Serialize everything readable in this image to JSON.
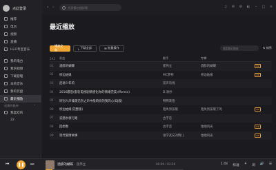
{
  "profile": {
    "login_label": "点此登录"
  },
  "sidebar": {
    "items": [
      {
        "label": "推荐",
        "active": false
      },
      {
        "label": "电台",
        "active": false
      },
      {
        "label": "视频",
        "active": false
      },
      {
        "label": "直播",
        "active": false
      },
      {
        "label": "Hi-Fi专区音乐",
        "active": false
      }
    ],
    "my_music": [
      {
        "label": "我的电台",
        "active": false
      },
      {
        "label": "我的视频",
        "active": false
      },
      {
        "label": "下载管理",
        "active": false
      },
      {
        "label": "本地音乐",
        "active": false
      },
      {
        "label": "我的云盘",
        "active": false
      },
      {
        "label": "最近播放",
        "active": true
      }
    ],
    "created_section": "创建的歌单",
    "liked": {
      "label": "我喜欢的",
      "count_label": "22"
    }
  },
  "topbar": {
    "search_placeholder": "大家都在搜好歌"
  },
  "main": {
    "title": "最近播放",
    "toolbar": {
      "play_all": "播放全部",
      "download_all": "下载全部",
      "batch": "批量操作",
      "search_placeholder": "搜索最近播放",
      "sort": "排序"
    },
    "columns": {
      "idx": "292",
      "title": "歌曲",
      "artist": "歌手",
      "album": "专辑"
    },
    "rows": [
      {
        "idx": "01",
        "title": "酒醉的蝴蝶",
        "artist": "崔伟立",
        "album": "酒醉的蝴蝶",
        "tag": "VIP"
      },
      {
        "idx": "02",
        "title": "桥边姑娘",
        "artist": "MC梦柯",
        "album": "桥边姑娘",
        "tag": "VIP"
      },
      {
        "idx": "03",
        "title": "后退少年的",
        "artist": "双声有线",
        "album": "",
        "tag": ""
      },
      {
        "idx": "04",
        "title": "2016最后(套装电视剧情感化你的情绪完美)(Remix)",
        "artist": "D.清抄",
        "album": "",
        "tag": ""
      },
      {
        "idx": "05",
        "title": "听别人声嗓落无奈之声中能响亮的我的心(DJ版)",
        "artist": "鸭鸭来抱",
        "album": "",
        "tag": ""
      },
      {
        "idx": "06",
        "title": "桥边姑娘(完整版)",
        "artist": "陌失男孩版",
        "album": "陌失男孩版了的",
        "tag": "VIP"
      },
      {
        "idx": "07",
        "title": "说猪水渡行路",
        "artist": "古字恋",
        "album": "",
        "tag": ""
      },
      {
        "idx": "08",
        "title": "回想春",
        "artist": "古字恋",
        "album": "怕他风光",
        "tag": "VIP"
      },
      {
        "idx": "09",
        "title": "现代爱情故事",
        "artist": "张学友兄对情儿",
        "album": "怕他风光",
        "tag": "VIP"
      }
    ]
  },
  "player": {
    "now_playing": "酒醉的蝴蝶",
    "artist": "崔伟立",
    "time": "00:09 / 03:26",
    "progress": 0.05,
    "speed": "1.0x",
    "quality": "标准",
    "accent": "#f0a431"
  },
  "icons": [
    "back-icon",
    "forward-icon",
    "search-icon",
    "play-icon",
    "prev-icon",
    "next-icon",
    "heart-icon",
    "volume-icon",
    "list-icon"
  ]
}
